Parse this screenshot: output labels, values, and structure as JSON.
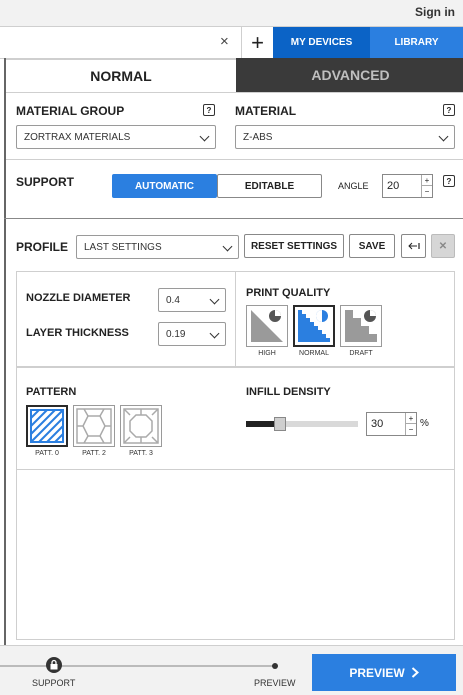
{
  "header": {
    "signin": "Sign in",
    "close": "×",
    "add": "+",
    "my_devices": "MY DEVICES",
    "library": "LIBRARY"
  },
  "modes": {
    "normal": "NORMAL",
    "advanced": "ADVANCED"
  },
  "material_group": {
    "label": "MATERIAL GROUP",
    "help": "?",
    "value": "ZORTRAX MATERIALS"
  },
  "material": {
    "label": "MATERIAL",
    "help": "?",
    "value": "Z-ABS"
  },
  "support": {
    "label": "SUPPORT",
    "automatic": "AUTOMATIC",
    "editable": "EDITABLE",
    "angle_label": "ANGLE",
    "angle_value": "20",
    "help": "?"
  },
  "profile": {
    "label": "PROFILE",
    "value": "LAST SETTINGS",
    "reset": "RESET SETTINGS",
    "save": "SAVE"
  },
  "nozzle": {
    "label": "NOZZLE DIAMETER",
    "value": "0.4"
  },
  "layer": {
    "label": "LAYER THICKNESS",
    "value": "0.19"
  },
  "print_quality": {
    "label": "PRINT QUALITY",
    "options": [
      {
        "name": "HIGH",
        "selected": false
      },
      {
        "name": "NORMAL",
        "selected": true
      },
      {
        "name": "DRAFT",
        "selected": false
      }
    ]
  },
  "pattern": {
    "label": "PATTERN",
    "options": [
      {
        "name": "PATT. 0",
        "selected": true
      },
      {
        "name": "PATT. 2",
        "selected": false
      },
      {
        "name": "PATT. 3",
        "selected": false
      }
    ]
  },
  "infill": {
    "label": "INFILL DENSITY",
    "value": "30",
    "unit": "%",
    "fraction": 0.3
  },
  "footer": {
    "step_support": "SUPPORT",
    "step_preview": "PREVIEW",
    "preview_button": "PREVIEW"
  },
  "colors": {
    "accent": "#2b7fe0",
    "dark_tab": "#3a3a3a"
  }
}
